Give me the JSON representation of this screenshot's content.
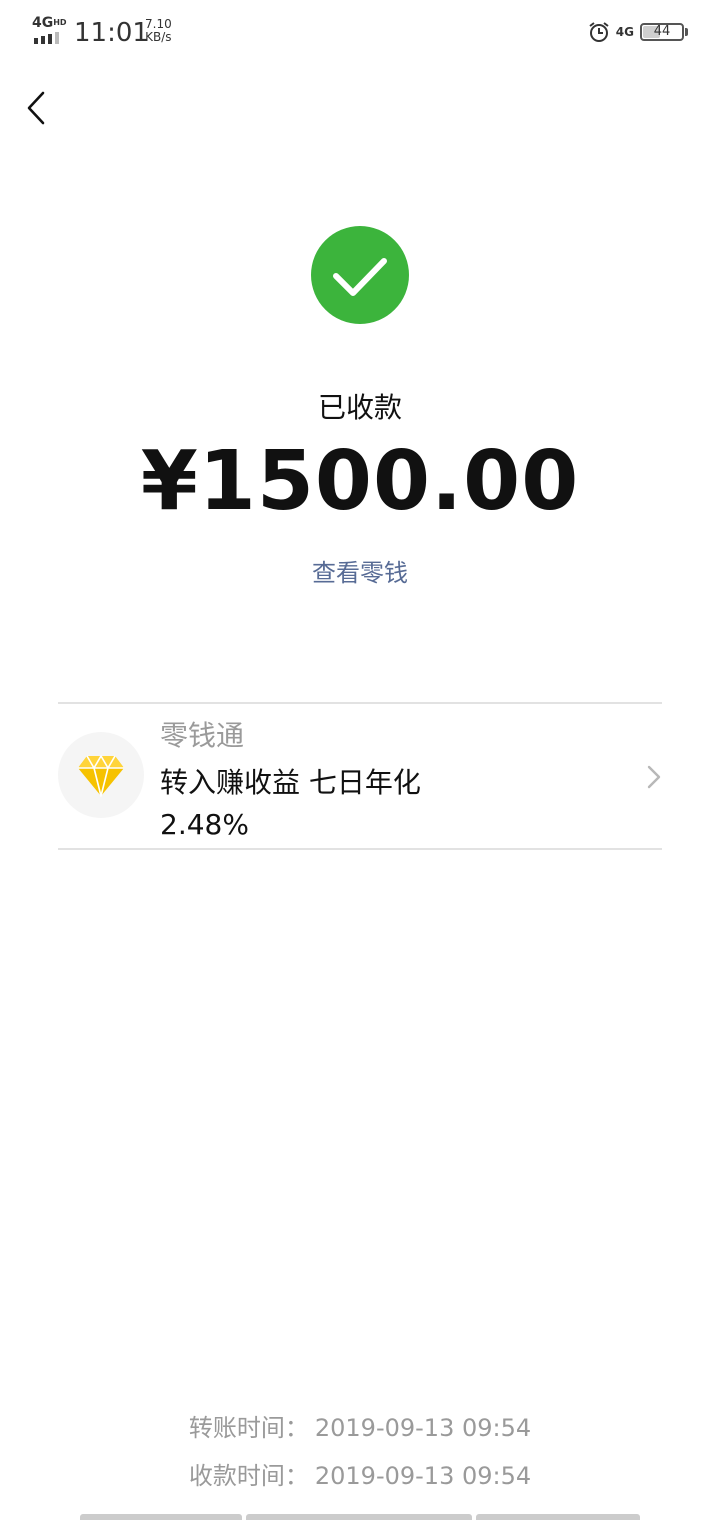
{
  "status_bar": {
    "network_label": "4G",
    "network_sup": "HD",
    "time": "11:01",
    "speed_value": "7.10",
    "speed_unit": "KB/s",
    "right_network": "4G",
    "battery": "44",
    "battery_level": 0.44
  },
  "page": {
    "status_label": "已收款",
    "amount": "¥1500.00",
    "view_balance_link": "查看零钱",
    "accent_green": "#3cb43c",
    "link_color": "#576b95"
  },
  "promo": {
    "name": "零钱通",
    "description": "转入赚收益 七日年化 2.48%",
    "icon": "diamond-icon",
    "icon_color": "#f6c200"
  },
  "times": [
    {
      "label": "转账时间：",
      "value": "2019-09-13 09:54"
    },
    {
      "label": "收款时间：",
      "value": "2019-09-13 09:54"
    }
  ]
}
